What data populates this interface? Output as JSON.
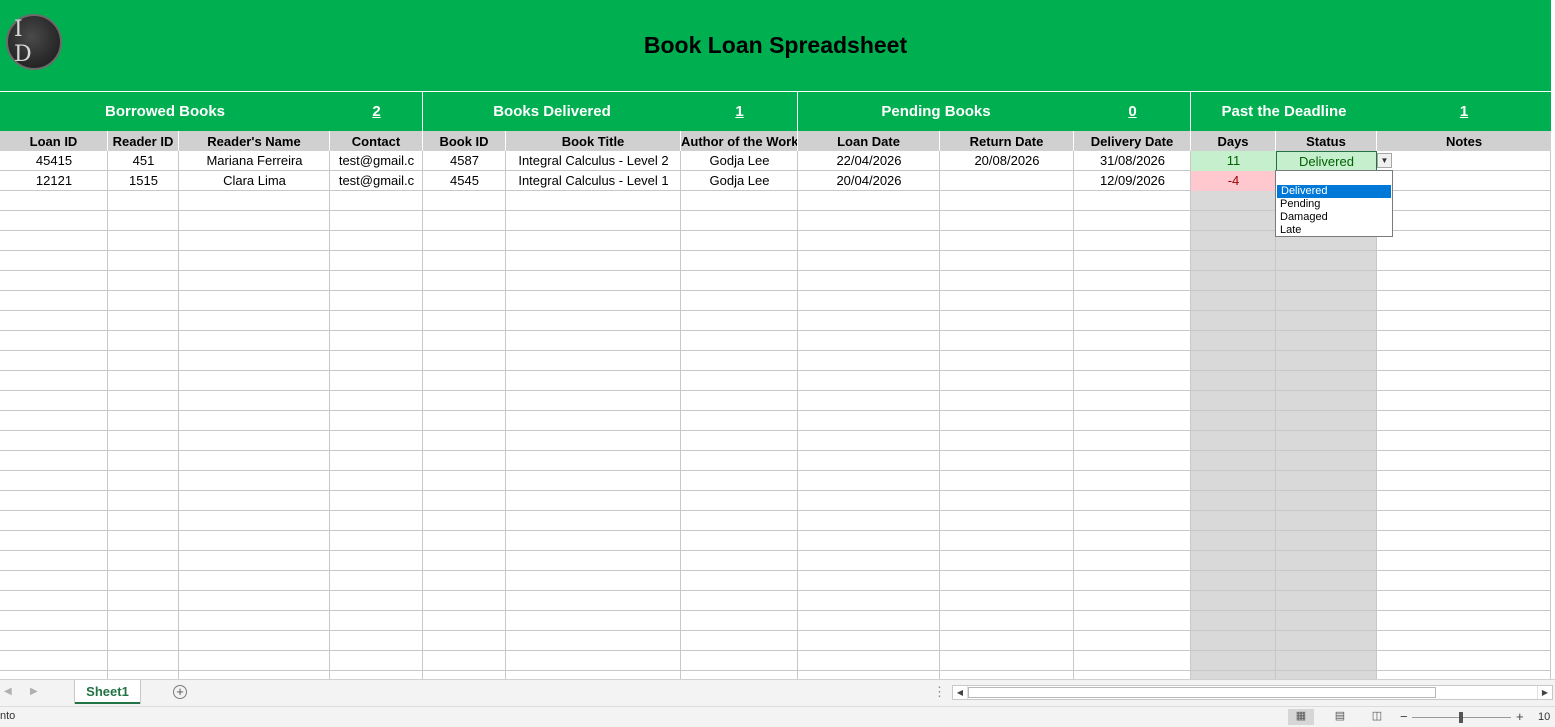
{
  "header": {
    "logo_text": "I D",
    "title": "Book Loan Spreadsheet"
  },
  "summary": [
    {
      "label": "Borrowed Books",
      "value": "2"
    },
    {
      "label": "Books Delivered",
      "value": "1"
    },
    {
      "label": "Pending Books",
      "value": "0"
    },
    {
      "label": "Past the Deadline",
      "value": "1"
    }
  ],
  "columns": [
    "Loan ID",
    "Reader ID",
    "Reader's Name",
    "Contact",
    "Book ID",
    "Book Title",
    "Author of the Work",
    "Loan Date",
    "Return Date",
    "Delivery Date",
    "Days",
    "Status",
    "Notes"
  ],
  "rows": [
    {
      "loan_id": "45415",
      "reader_id": "451",
      "reader_name": "Mariana Ferreira",
      "contact": "test@gmail.c",
      "book_id": "4587",
      "book_title": "Integral Calculus - Level 2",
      "author": "Godja Lee",
      "loan_date": "22/04/2026",
      "return_date": "20/08/2026",
      "delivery_date": "31/08/2026",
      "days": "11",
      "status": "Delivered",
      "notes": ""
    },
    {
      "loan_id": "12121",
      "reader_id": "1515",
      "reader_name": "Clara Lima",
      "contact": "test@gmail.c",
      "book_id": "4545",
      "book_title": "Integral Calculus - Level 1",
      "author": "Godja Lee",
      "loan_date": "20/04/2026",
      "return_date": "",
      "delivery_date": "12/09/2026",
      "days": "-4",
      "status": "",
      "notes": ""
    }
  ],
  "status_dropdown": {
    "options": [
      "Delivered",
      "Pending",
      "Damaged",
      "Late"
    ],
    "selected": "Delivered"
  },
  "sheet_tabs": {
    "active": "Sheet1",
    "add_icon": "plus-circle-icon"
  },
  "status_bar": {
    "mode_text": "nto",
    "zoom_label": "10"
  },
  "colors": {
    "banner": "#00b050",
    "header_gray": "#d0d0d0",
    "positive_fill": "#c6efce",
    "negative_fill": "#ffc7ce",
    "accent": "#217346"
  }
}
